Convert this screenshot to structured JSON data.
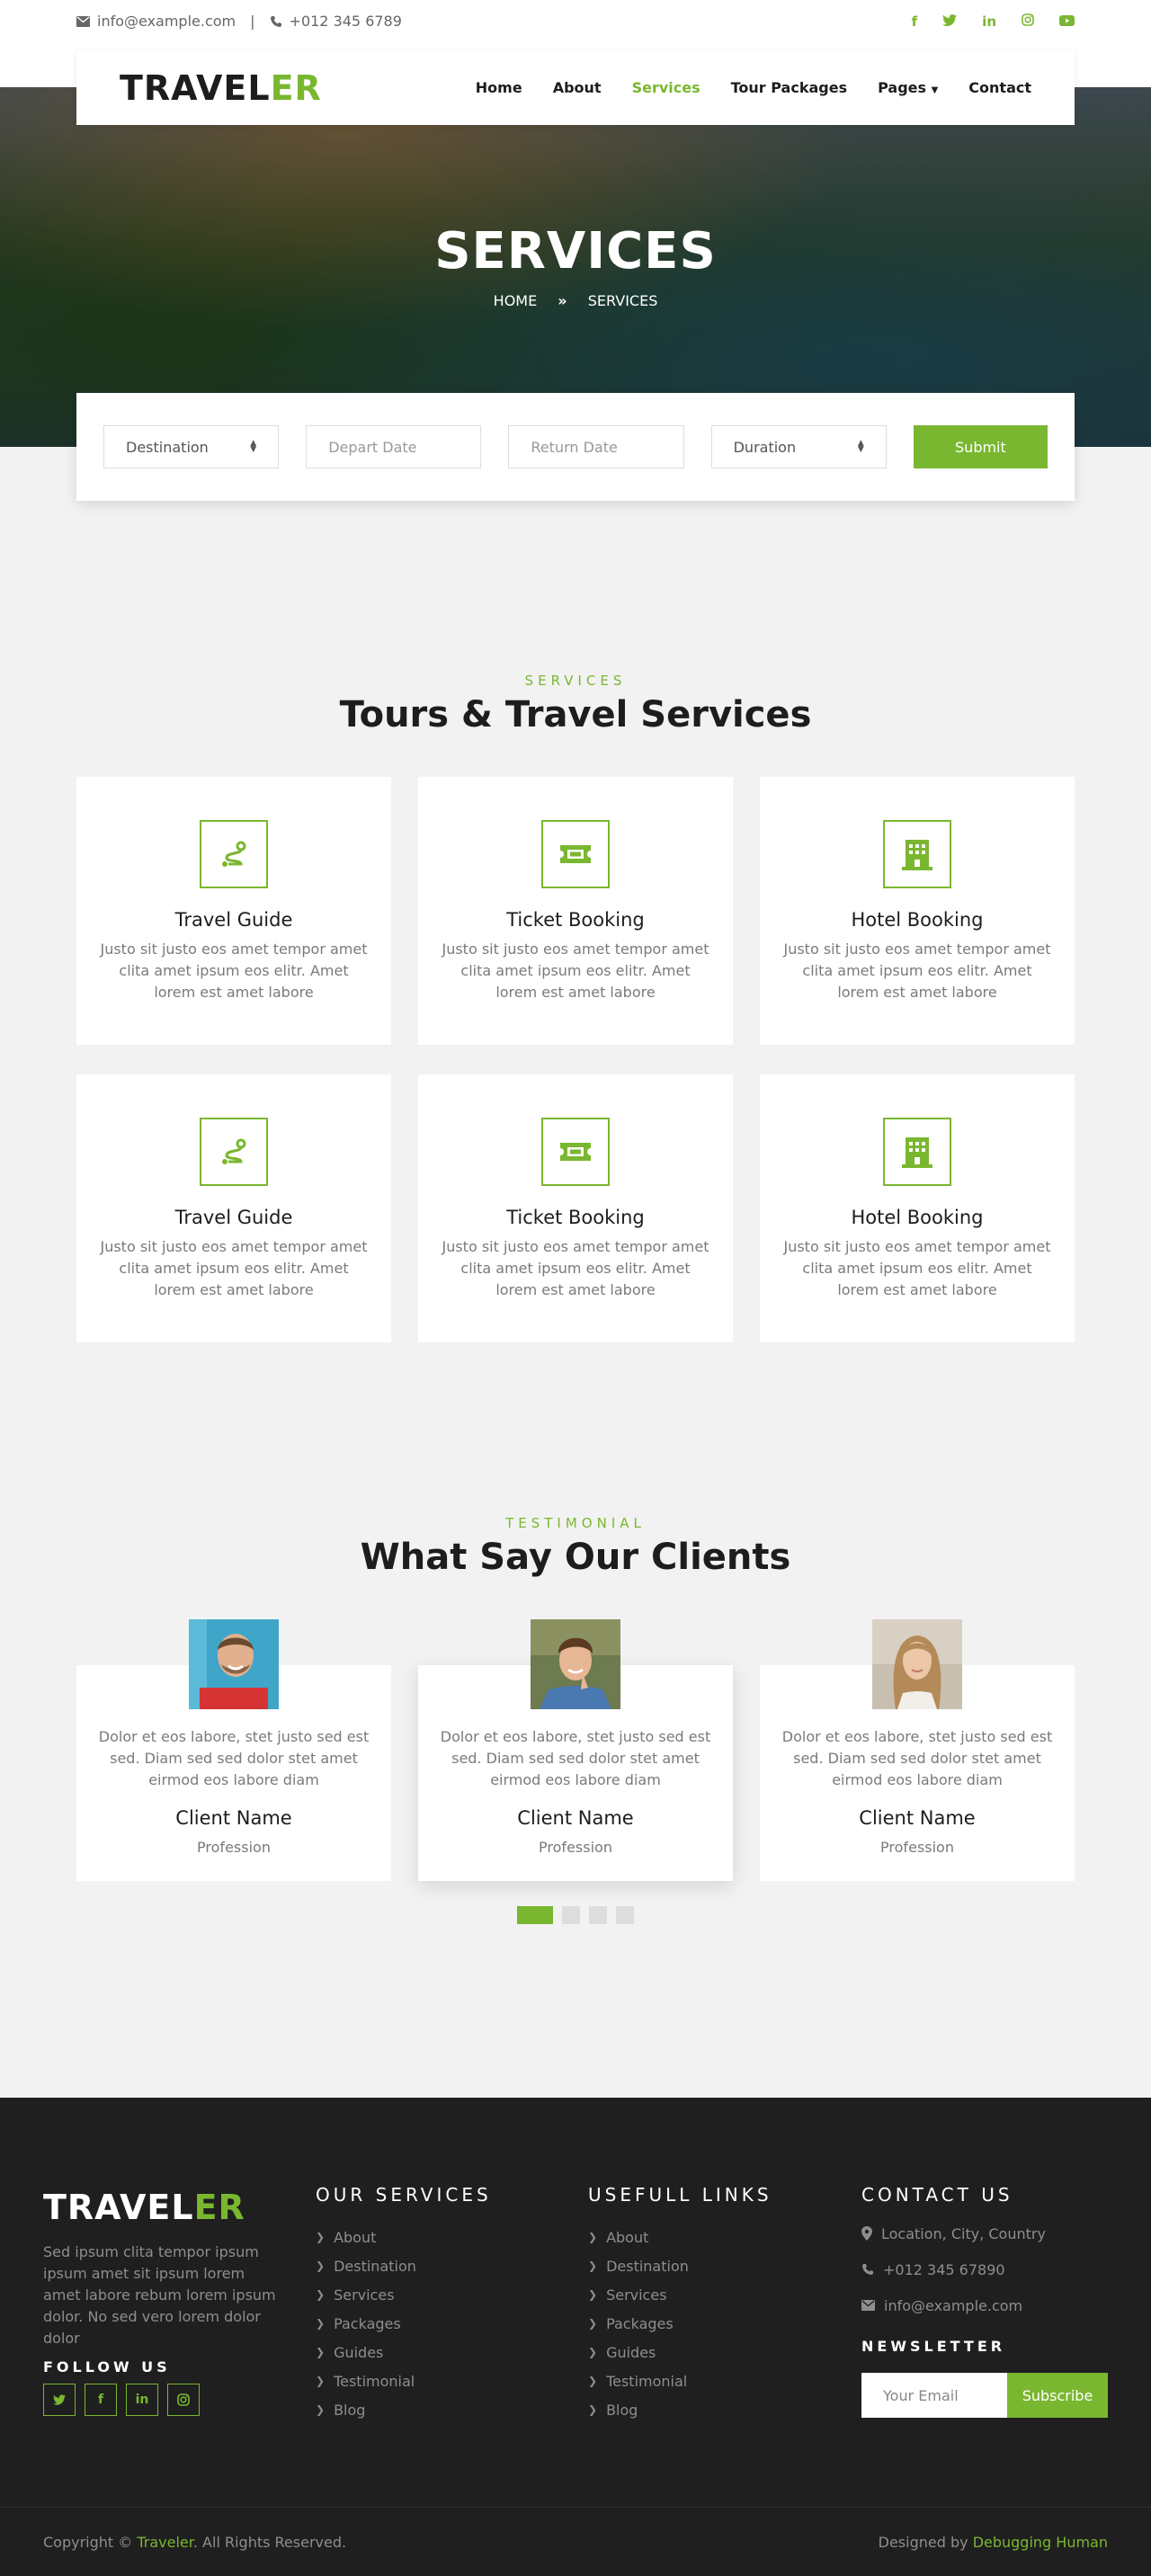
{
  "topbar": {
    "email": "info@example.com",
    "phone": "+012 345 6789",
    "socials": [
      "facebook-icon",
      "twitter-icon",
      "linkedin-icon",
      "instagram-icon",
      "youtube-icon"
    ]
  },
  "nav": {
    "logo_a": "TRAVEL",
    "logo_b": "ER",
    "items": [
      "Home",
      "About",
      "Services",
      "Tour Packages",
      "Pages",
      "Contact"
    ],
    "active": "Services"
  },
  "hero": {
    "title": "SERVICES",
    "crumb_home": "HOME",
    "crumb_current": "SERVICES"
  },
  "booking": {
    "destination": "Destination",
    "depart": "Depart Date",
    "return": "Return Date",
    "duration": "Duration",
    "submit": "Submit"
  },
  "services": {
    "label": "SERVICES",
    "title": "Tours & Travel Services",
    "items": [
      {
        "title": "Travel Guide",
        "text": "Justo sit justo eos amet tempor amet clita amet ipsum eos elitr. Amet lorem est amet labore",
        "icon": "route-icon"
      },
      {
        "title": "Ticket Booking",
        "text": "Justo sit justo eos amet tempor amet clita amet ipsum eos elitr. Amet lorem est amet labore",
        "icon": "ticket-icon"
      },
      {
        "title": "Hotel Booking",
        "text": "Justo sit justo eos amet tempor amet clita amet ipsum eos elitr. Amet lorem est amet labore",
        "icon": "hotel-icon"
      },
      {
        "title": "Travel Guide",
        "text": "Justo sit justo eos amet tempor amet clita amet ipsum eos elitr. Amet lorem est amet labore",
        "icon": "route-icon"
      },
      {
        "title": "Ticket Booking",
        "text": "Justo sit justo eos amet tempor amet clita amet ipsum eos elitr. Amet lorem est amet labore",
        "icon": "ticket-icon"
      },
      {
        "title": "Hotel Booking",
        "text": "Justo sit justo eos amet tempor amet clita amet ipsum eos elitr. Amet lorem est amet labore",
        "icon": "hotel-icon"
      }
    ]
  },
  "testimonials": {
    "label": "TESTIMONIAL",
    "title": "What Say Our Clients",
    "items": [
      {
        "text": "Dolor et eos labore, stet justo sed est sed. Diam sed sed dolor stet amet eirmod eos labore diam",
        "name": "Client Name",
        "profession": "Profession"
      },
      {
        "text": "Dolor et eos labore, stet justo sed est sed. Diam sed sed dolor stet amet eirmod eos labore diam",
        "name": "Client Name",
        "profession": "Profession"
      },
      {
        "text": "Dolor et eos labore, stet justo sed est sed. Diam sed sed dolor stet amet eirmod eos labore diam",
        "name": "Client Name",
        "profession": "Profession"
      }
    ]
  },
  "footer": {
    "logo_a": "TRAVEL",
    "logo_b": "ER",
    "about": "Sed ipsum clita tempor ipsum ipsum amet sit ipsum lorem amet labore rebum lorem ipsum dolor. No sed vero lorem dolor dolor",
    "follow": "FOLLOW US",
    "services_title": "OUR SERVICES",
    "services_links": [
      "About",
      "Destination",
      "Services",
      "Packages",
      "Guides",
      "Testimonial",
      "Blog"
    ],
    "useful_title": "USEFULL LINKS",
    "useful_links": [
      "About",
      "Destination",
      "Services",
      "Packages",
      "Guides",
      "Testimonial",
      "Blog"
    ],
    "contact_title": "CONTACT US",
    "location": "Location, City, Country",
    "phone": "+012 345 67890",
    "email": "info@example.com",
    "newsletter_title": "NEWSLETTER",
    "newsletter_placeholder": "Your Email",
    "subscribe": "Subscribe",
    "copyright_a": "Copyright ©",
    "copyright_brand": "Traveler",
    "copyright_b": ". All Rights Reserved.",
    "designed_a": "Designed by",
    "designed_brand": "Debugging Human"
  },
  "colors": {
    "accent": "#7ab730",
    "dark": "#1f1f1f",
    "text": "#1d1d1d"
  }
}
